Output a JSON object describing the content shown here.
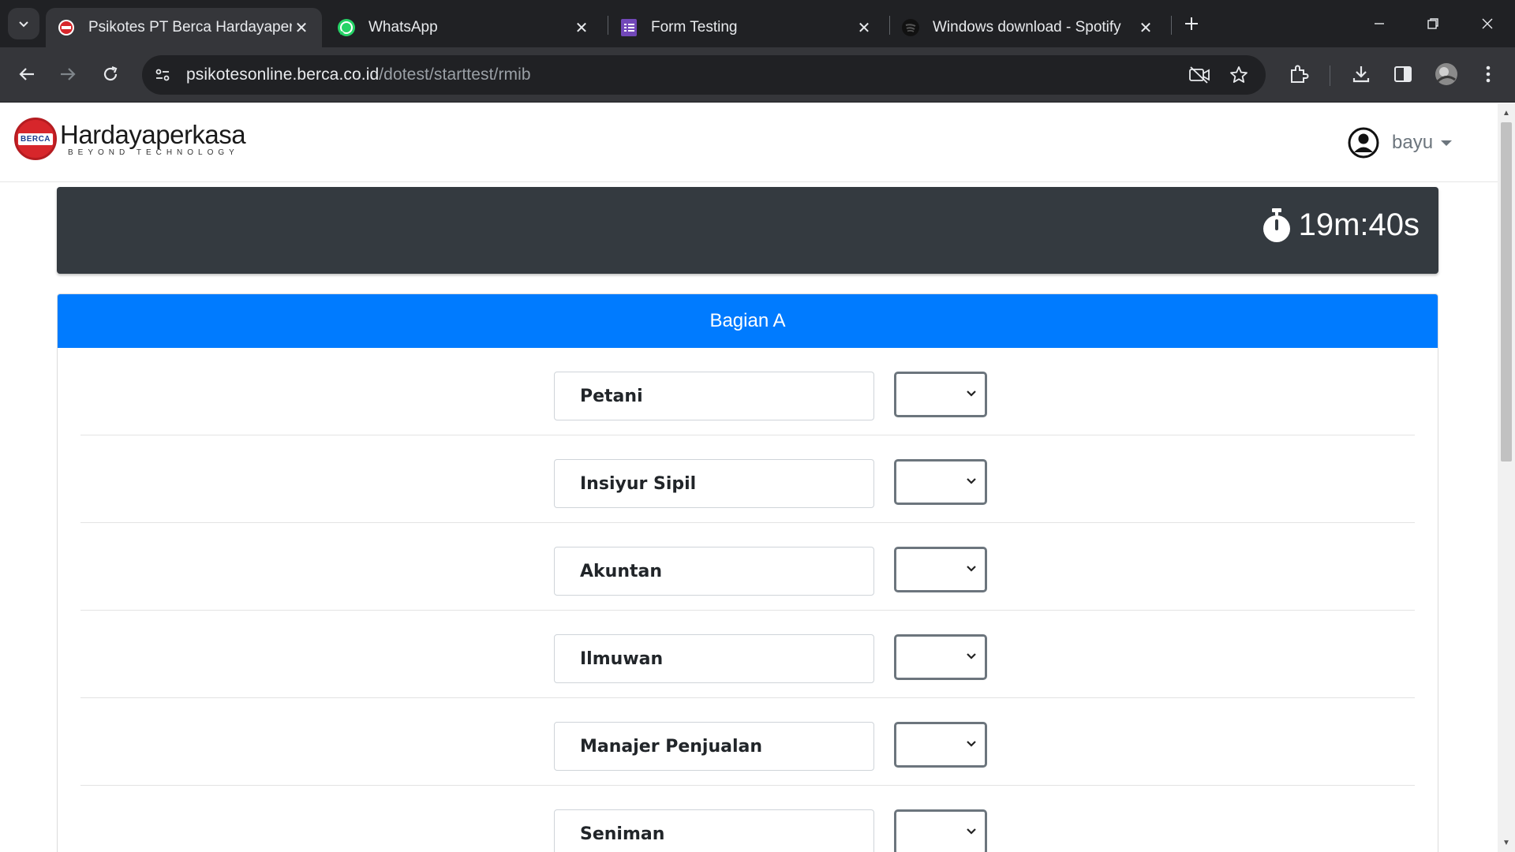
{
  "browser": {
    "tabs": [
      {
        "title": "Psikotes PT Berca Hardayaperkasa",
        "icon": "berca-favicon",
        "active": true
      },
      {
        "title": "WhatsApp",
        "icon": "whatsapp-icon",
        "active": false
      },
      {
        "title": "Form Testing",
        "icon": "google-forms-icon",
        "active": false
      },
      {
        "title": "Windows download - Spotify",
        "icon": "spotify-icon",
        "active": false
      }
    ],
    "url_host": "psikotesonline.berca.co.id",
    "url_path": "/dotest/starttest/rmib"
  },
  "header": {
    "logo_badge": "BERCA",
    "logo_name": "Hardayaperkasa",
    "logo_tagline": "BEYOND TECHNOLOGY",
    "username": "bayu"
  },
  "timer": {
    "remaining": "19m:40s"
  },
  "section": {
    "title": "Bagian A",
    "rows": [
      {
        "job": "Petani",
        "rank": ""
      },
      {
        "job": "Insiyur Sipil",
        "rank": ""
      },
      {
        "job": "Akuntan",
        "rank": ""
      },
      {
        "job": "Ilmuwan",
        "rank": ""
      },
      {
        "job": "Manajer Penjualan",
        "rank": ""
      },
      {
        "job": "Seniman",
        "rank": ""
      }
    ]
  },
  "colors": {
    "chrome_dark": "#202124",
    "chrome_toolbar": "#35363a",
    "timer_bar": "#343a40",
    "section_header": "#007bff"
  }
}
